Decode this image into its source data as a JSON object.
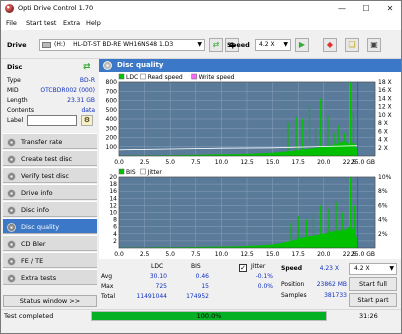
{
  "window": {
    "title": "Opti Drive Control 1.70",
    "controls": {
      "minimize": "—",
      "maximize": "☐",
      "close": "✕"
    }
  },
  "menu": [
    "File",
    "Start test",
    "Extra",
    "Help"
  ],
  "drive_bar": {
    "drive_label": "Drive",
    "drive_letter": "(H:)",
    "drive_name": "HL-DT-ST BD-RE  WH16NS48 1.D3",
    "speed_label": "Speed",
    "speed_value": "4.2 X",
    "icons": [
      "eject-icon",
      "copy-icon",
      "erase-icon",
      "settings-icon",
      "save-icon"
    ]
  },
  "disc": {
    "header": "Disc",
    "rows": [
      {
        "key": "Type",
        "value": "BD-R"
      },
      {
        "key": "MID",
        "value": "OTCBDR002 (000)"
      },
      {
        "key": "Length",
        "value": "23.31 GB"
      },
      {
        "key": "Contents",
        "value": "data"
      }
    ],
    "label_key": "Label",
    "label_value": ""
  },
  "nav": [
    {
      "label": "Transfer rate",
      "active": false
    },
    {
      "label": "Create test disc",
      "active": false
    },
    {
      "label": "Verify test disc",
      "active": false
    },
    {
      "label": "Drive info",
      "active": false
    },
    {
      "label": "Disc info",
      "active": false
    },
    {
      "label": "Disc quality",
      "active": true
    },
    {
      "label": "CD Bler",
      "active": false
    },
    {
      "label": "FE / TE",
      "active": false
    },
    {
      "label": "Extra tests",
      "active": false
    }
  ],
  "status_window_button": "Status window >>",
  "main": {
    "title": "Disc quality"
  },
  "chart_data": [
    {
      "type": "area",
      "series": [
        {
          "name": "LDC",
          "color": "#00c000"
        },
        {
          "name": "Read speed",
          "color": "#ffffff"
        },
        {
          "name": "Write speed",
          "color": "#ff66ff"
        }
      ],
      "x_ticks": [
        "0.0",
        "2.5",
        "5.0",
        "7.5",
        "10.0",
        "12.5",
        "15.0",
        "17.5",
        "20.0",
        "22.5",
        "25.0 GB"
      ],
      "xlim": [
        0,
        25
      ],
      "y_left_ticks": [
        "100",
        "200",
        "300",
        "400",
        "500",
        "600",
        "700",
        "800"
      ],
      "ylim": [
        0,
        800
      ],
      "y_right_ticks": [
        "2 X",
        "4 X",
        "6 X",
        "8 X",
        "10 X",
        "12 X",
        "14 X",
        "16 X",
        "18 X"
      ],
      "y_right_lim": [
        0,
        18
      ],
      "ldc_profile": [
        [
          0,
          3
        ],
        [
          1,
          4
        ],
        [
          2,
          5
        ],
        [
          3,
          5
        ],
        [
          4,
          7
        ],
        [
          5,
          8
        ],
        [
          6,
          10
        ],
        [
          7,
          12
        ],
        [
          8,
          14
        ],
        [
          9,
          16
        ],
        [
          10,
          18
        ],
        [
          11,
          20
        ],
        [
          12,
          22
        ],
        [
          13,
          25
        ],
        [
          14,
          30
        ],
        [
          15,
          35
        ],
        [
          16,
          45
        ],
        [
          17,
          55
        ],
        [
          18,
          70
        ],
        [
          19,
          85
        ],
        [
          20,
          100
        ],
        [
          21,
          120
        ],
        [
          22,
          160
        ],
        [
          22.5,
          130
        ],
        [
          23,
          140
        ],
        [
          23.3,
          60
        ]
      ],
      "ldc_spikes": [
        [
          16.5,
          360
        ],
        [
          17.3,
          420
        ],
        [
          17.9,
          400
        ],
        [
          18.6,
          540
        ],
        [
          19.2,
          310
        ],
        [
          19.7,
          620
        ],
        [
          20.4,
          430
        ],
        [
          21.0,
          250
        ],
        [
          21.4,
          330
        ],
        [
          22.0,
          250
        ],
        [
          22.6,
          800
        ],
        [
          22.9,
          470
        ]
      ],
      "read_speed": [
        [
          0,
          1.5
        ],
        [
          5,
          1.7
        ],
        [
          10,
          1.9
        ],
        [
          15,
          2.0
        ],
        [
          20,
          2.3
        ],
        [
          23.3,
          2.5
        ]
      ],
      "grid": true
    },
    {
      "type": "area",
      "series": [
        {
          "name": "BIS",
          "color": "#00c000"
        },
        {
          "name": "Jitter",
          "color": "#ffffff"
        }
      ],
      "x_ticks": [
        "0.0",
        "2.5",
        "5.0",
        "7.5",
        "10.0",
        "12.5",
        "15.0",
        "17.5",
        "20.0",
        "22.5",
        "25.0 GB"
      ],
      "xlim": [
        0,
        25
      ],
      "y_left_ticks": [
        "2",
        "4",
        "6",
        "8",
        "10",
        "12",
        "14",
        "16",
        "18",
        "20"
      ],
      "ylim": [
        0,
        20
      ],
      "y_right_ticks": [
        "2%",
        "4%",
        "6%",
        "8%",
        "10%"
      ],
      "y_right_lim": [
        0,
        10
      ],
      "bis_profile": [
        [
          0,
          0.1
        ],
        [
          2,
          0.1
        ],
        [
          4,
          0.2
        ],
        [
          6,
          0.2
        ],
        [
          8,
          0.3
        ],
        [
          10,
          0.4
        ],
        [
          12,
          0.5
        ],
        [
          14,
          0.8
        ],
        [
          15,
          1.0
        ],
        [
          16,
          1.5
        ],
        [
          17,
          2.2
        ],
        [
          18,
          3.0
        ],
        [
          19,
          3.5
        ],
        [
          20,
          4.0
        ],
        [
          21,
          4.8
        ],
        [
          22,
          5.0
        ],
        [
          22.5,
          6.0
        ],
        [
          23,
          5.0
        ],
        [
          23.3,
          2.0
        ]
      ],
      "bis_spikes": [
        [
          16.8,
          7
        ],
        [
          17.5,
          9
        ],
        [
          18.3,
          8
        ],
        [
          19.0,
          10
        ],
        [
          19.7,
          12
        ],
        [
          20.5,
          11
        ],
        [
          21.2,
          13
        ],
        [
          21.8,
          10
        ],
        [
          22.6,
          20
        ],
        [
          23.0,
          12
        ]
      ],
      "grid": true
    }
  ],
  "stats": {
    "col_ldc": "LDC",
    "col_bis": "BIS",
    "rows": [
      {
        "label": "Avg",
        "ldc": "30.10",
        "bis": "0.46",
        "jitter": "-0.1%"
      },
      {
        "label": "Max",
        "ldc": "725",
        "bis": "15",
        "jitter": "0.0%"
      },
      {
        "label": "Total",
        "ldc": "11491044",
        "bis": "174952",
        "jitter": ""
      }
    ],
    "jitter_label": "Jitter",
    "jitter_checked": true,
    "speed_label": "Speed",
    "speed_value": "4.23 X",
    "speed_select": "4.2 X",
    "position_label": "Position",
    "position_value": "23862 MB",
    "samples_label": "Samples",
    "samples_value": "381733",
    "start_full": "Start full",
    "start_part": "Start part"
  },
  "statusbar": {
    "text": "Test completed",
    "progress_percent": 100,
    "progress_text": "100.0%",
    "time": "31:26"
  },
  "colors": {
    "accent": "#3c78c8",
    "plot_bg": "#5a7a9a",
    "ldc": "#00c000",
    "progress": "#06b025",
    "value_text": "#1030c0"
  }
}
